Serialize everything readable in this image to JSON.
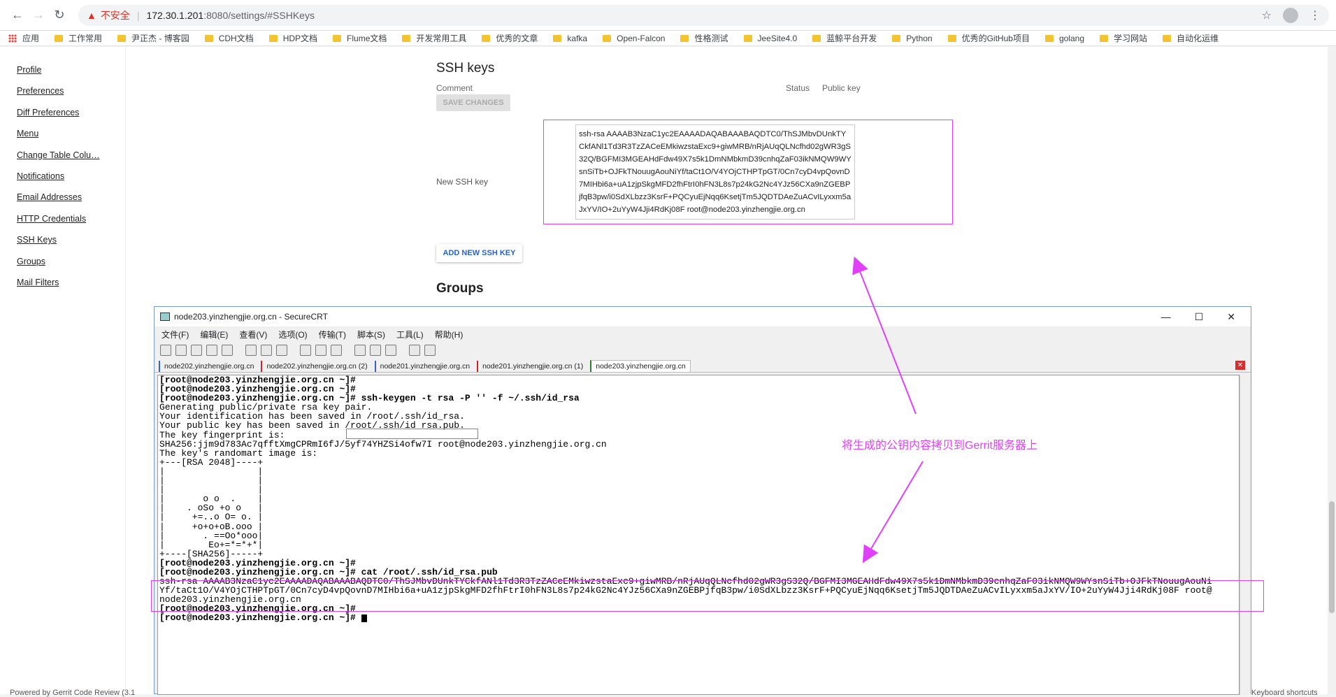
{
  "browser": {
    "insecure_label": "不安全",
    "url_host": "172.30.1.201",
    "url_path": ":8080/settings/#SSHKeys"
  },
  "bookmarks": [
    "应用",
    "工作常用",
    "尹正杰 - 博客园",
    "CDH文档",
    "HDP文档",
    "Flume文档",
    "开发常用工具",
    "优秀的文章",
    "kafka",
    "Open-Falcon",
    "性格测试",
    "JeeSite4.0",
    "蓝鲸平台开发",
    "Python",
    "优秀的GitHub项目",
    "golang",
    "学习网站",
    "自动化运维"
  ],
  "nav": {
    "items": [
      "Profile",
      "Preferences",
      "Diff Preferences",
      "Menu",
      "Change Table Colu…",
      "Notifications",
      "Email Addresses",
      "HTTP Credentials",
      "SSH Keys",
      "Groups",
      "Mail Filters"
    ]
  },
  "ssh": {
    "title": "SSH keys",
    "comment_header": "Comment",
    "status_header": "Status",
    "pubkey_header": "Public key",
    "save_button": "SAVE CHANGES",
    "new_key_label": "New SSH key",
    "new_key_value": "ssh-rsa AAAAB3NzaC1yc2EAAAADAQABAAABAQDTC0/ThSJMbvDUnkTYCkfANl1Td3R3TzZACeEMkiwzstaExc9+giwMRB/nRjAUqQLNcfhd02gWR3gS32Q/BGFMI3MGEAHdFdw49X7s5k1DmNMbkmD39cnhqZaF03ikNMQW9WYsnSiTb+OJFkTNouugAouNiYf/taCt1O/V4YOjCTHPTpGT/0Cn7cyD4vpQovnD7MIHbi6a+uA1zjpSkgMFD2fhFtrI0hFN3L8s7p24kG2Nc4YJz56CXa9nZGEBPjfqB3pw/i0SdXLbzz3KsrF+PQCyuEjNqq6KsetjTm5JQDTDAeZuACvILyxxm5aJxYV/IO+2uYyW4Jji4RdKj08F root@node203.yinzhengjie.org.cn",
    "add_button": "ADD NEW SSH KEY",
    "groups_title": "Groups"
  },
  "footer": {
    "left": "Powered by Gerrit Code Review (3.1",
    "right": "Keyboard shortcuts"
  },
  "annotation": "将生成的公钥内容拷贝到Gerrit服务器上",
  "crt": {
    "title": "node203.yinzhengjie.org.cn - SecureCRT",
    "menu": [
      "文件(F)",
      "编辑(E)",
      "查看(V)",
      "选项(O)",
      "传输(T)",
      "脚本(S)",
      "工具(L)",
      "帮助(H)"
    ],
    "tabs": [
      "node202.yinzhengjie.org.cn",
      "node202.yinzhengjie.org.cn (2)",
      "node201.yinzhengjie.org.cn",
      "node201.yinzhengjie.org.cn (1)",
      "node203.yinzhengjie.org.cn"
    ],
    "terminal_lines": [
      "[root@node203.yinzhengjie.org.cn ~]#",
      "[root@node203.yinzhengjie.org.cn ~]#",
      "[root@node203.yinzhengjie.org.cn ~]# ssh-keygen -t rsa -P '' -f ~/.ssh/id_rsa",
      "Generating public/private rsa key pair.",
      "Your identification has been saved in /root/.ssh/id_rsa.",
      "Your public key has been saved in /root/.ssh/id_rsa.pub.",
      "The key fingerprint is:",
      "SHA256:jjm9d783Ac7qfftXmgCPRmI6fJ/5yf74YHZSi4ofw7I root@node203.yinzhengjie.org.cn",
      "The key's randomart image is:",
      "+---[RSA 2048]----+",
      "|                 |",
      "|                 |",
      "|                 |",
      "|       o o  .    |",
      "|    . oSo +o o   |",
      "|     +=..o O= o. |",
      "|     +o+o+oB.ooo |",
      "|       . ==Oo*ooo|",
      "|        Eo+=*=*+*|",
      "+----[SHA256]-----+",
      "[root@node203.yinzhengjie.org.cn ~]#",
      "[root@node203.yinzhengjie.org.cn ~]# cat /root/.ssh/id_rsa.pub",
      "ssh-rsa AAAAB3NzaC1yc2EAAAADAQABAAABAQDTC0/ThSJMbvDUnkTYCkfANl1Td3R3TzZACeEMkiwzstaExc9+giwMRB/nRjAUqQLNcfhd02gWR3gS32Q/BGFMI3MGEAHdFdw49X7s5k1DmNMbkmD39cnhqZaF03ikNMQW9WYsnSiTb+OJFkTNouugAouNi",
      "Yf/taCt1O/V4YOjCTHPTpGT/0Cn7cyD4vpQovnD7MIHbi6a+uA1zjpSkgMFD2fhFtrI0hFN3L8s7p24kG2Nc4YJz56CXa9nZGEBPjfqB3pw/i0SdXLbzz3KsrF+PQCyuEjNqq6KsetjTm5JQDTDAeZuACvILyxxm5aJxYV/IO+2uYyW4Jji4RdKj08F root@",
      "node203.yinzhengjie.org.cn",
      "[root@node203.yinzhengjie.org.cn ~]#",
      "[root@node203.yinzhengjie.org.cn ~]# "
    ]
  },
  "colors": {
    "annotation": "#e040fb",
    "link_blue": "#2a62c9"
  }
}
